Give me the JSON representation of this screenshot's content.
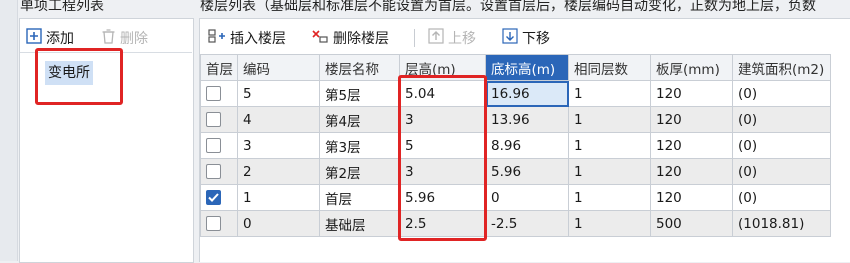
{
  "left_panel": {
    "title": "单项工程列表",
    "add_label": "添加",
    "delete_label": "删除",
    "items": [
      "变电所"
    ]
  },
  "right_panel": {
    "title": "楼层列表（基础层和标准层不能设置为首层。设置首层后，楼层编码自动变化，正数为地上层，负数",
    "toolbar": {
      "insert_label": "插入楼层",
      "delete_label": "删除楼层",
      "up_label": "上移",
      "down_label": "下移"
    },
    "columns": [
      "首层",
      "编码",
      "楼层名称",
      "层高(m)",
      "底标高(m)",
      "相同层数",
      "板厚(mm)",
      "建筑面积(m2)"
    ],
    "rows": [
      {
        "first": false,
        "code": "5",
        "name": "第5层",
        "height": "5.04",
        "base": "16.96",
        "same": "1",
        "thick": "120",
        "area": "(0)"
      },
      {
        "first": false,
        "code": "4",
        "name": "第4层",
        "height": "3",
        "base": "13.96",
        "same": "1",
        "thick": "120",
        "area": "(0)"
      },
      {
        "first": false,
        "code": "3",
        "name": "第3层",
        "height": "5",
        "base": "8.96",
        "same": "1",
        "thick": "120",
        "area": "(0)"
      },
      {
        "first": false,
        "code": "2",
        "name": "第2层",
        "height": "3",
        "base": "5.96",
        "same": "1",
        "thick": "120",
        "area": "(0)"
      },
      {
        "first": true,
        "code": "1",
        "name": "首层",
        "height": "5.96",
        "base": "0",
        "same": "1",
        "thick": "120",
        "area": "(0)"
      },
      {
        "first": false,
        "code": "0",
        "name": "基础层",
        "height": "2.5",
        "base": "-2.5",
        "same": "1",
        "thick": "500",
        "area": "(1018.81)"
      }
    ]
  },
  "colors": {
    "highlight_red": "#e02424",
    "accent_blue": "#2b66b8",
    "selection": "#dbe9f8"
  }
}
